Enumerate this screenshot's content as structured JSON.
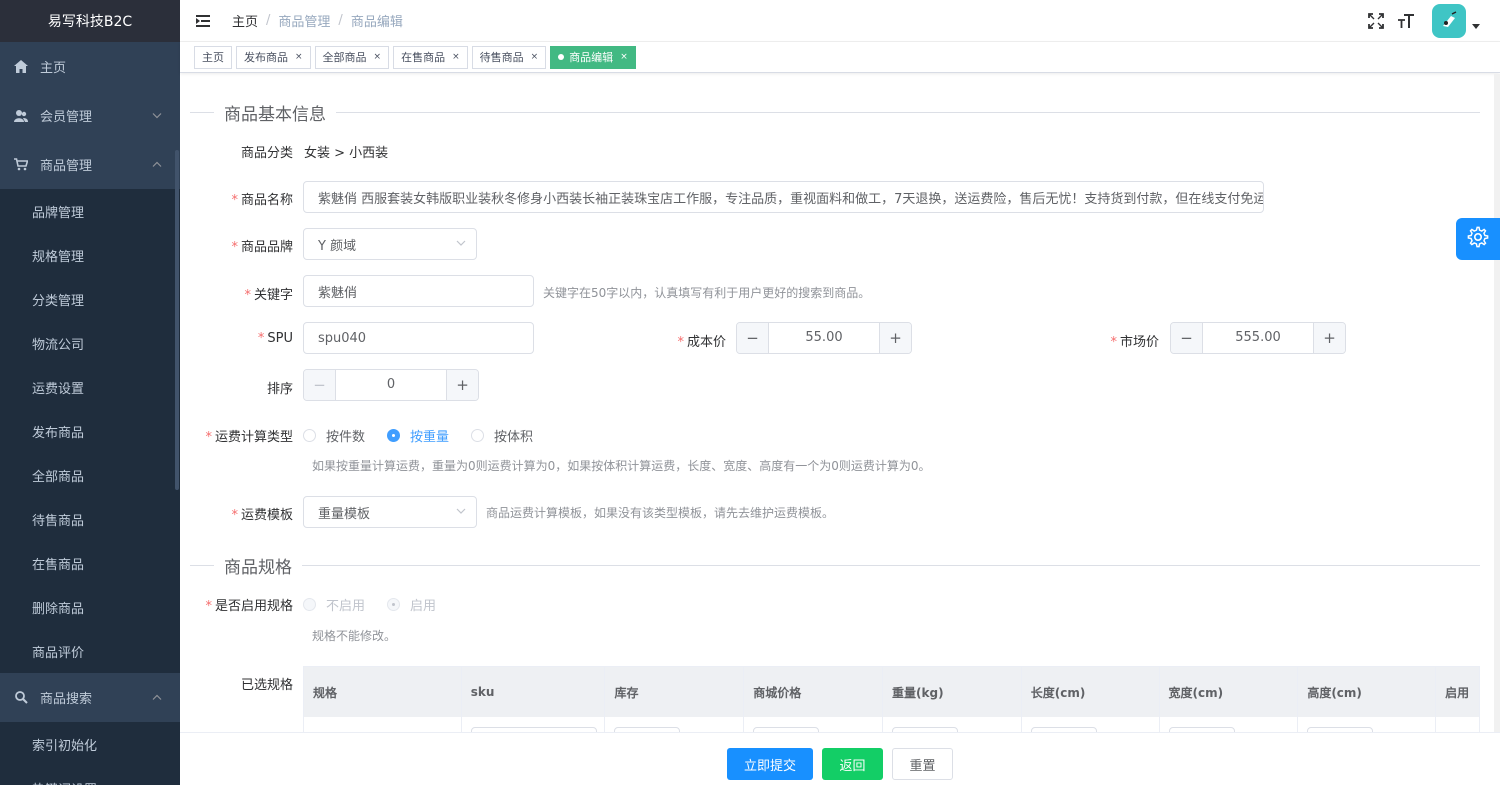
{
  "app": {
    "title": "易写科技B2C"
  },
  "sidebar": {
    "items": [
      {
        "label": "主页",
        "icon": "home-icon"
      },
      {
        "label": "会员管理",
        "icon": "user-icon"
      },
      {
        "label": "商品管理",
        "icon": "cart-icon"
      }
    ],
    "goods_sub": [
      "品牌管理",
      "规格管理",
      "分类管理",
      "物流公司",
      "运费设置",
      "发布商品",
      "全部商品",
      "待售商品",
      "在售商品",
      "删除商品",
      "商品评价"
    ],
    "search": {
      "label": "商品搜索",
      "icon": "search-icon"
    },
    "search_sub": [
      "索引初始化",
      "热键词设置"
    ]
  },
  "breadcrumb": [
    "主页",
    "商品管理",
    "商品编辑"
  ],
  "tabs": [
    {
      "label": "主页",
      "closable": false
    },
    {
      "label": "发布商品",
      "closable": true
    },
    {
      "label": "全部商品",
      "closable": true
    },
    {
      "label": "在售商品",
      "closable": true
    },
    {
      "label": "待售商品",
      "closable": true
    },
    {
      "label": "商品编辑",
      "closable": true,
      "active": true
    }
  ],
  "sections": {
    "basic": "商品基本信息",
    "spec": "商品规格"
  },
  "form": {
    "category": {
      "label": "商品分类",
      "value": "女装 > 小西装"
    },
    "name": {
      "label": "商品名称",
      "value": "紫魅俏 西服套装女韩版职业装秋冬修身小西装长袖正装珠宝店工作服，专注品质，重视面料和做工，7天退换，送运费险，售后无忧！支持货到付款，但在线支付免运费！"
    },
    "brand": {
      "label": "商品品牌",
      "value": "Y 颜域"
    },
    "keyword": {
      "label": "关键字",
      "value": "紫魅俏",
      "hint": "关键字在50字以内，认真填写有利于用户更好的搜索到商品。"
    },
    "spu": {
      "label": "SPU",
      "value": "spu040"
    },
    "cost": {
      "label": "成本价",
      "value": "55.00"
    },
    "market": {
      "label": "市场价",
      "value": "555.00"
    },
    "sort": {
      "label": "排序",
      "value": "0"
    },
    "freight_type": {
      "label": "运费计算类型",
      "options": [
        "按件数",
        "按重量",
        "按体积"
      ],
      "selected": "按重量",
      "hint": "如果按重量计算运费，重量为0则运费计算为0，如果按体积计算运费，长度、宽度、高度有一个为0则运费计算为0。"
    },
    "freight_template": {
      "label": "运费模板",
      "value": "重量模板",
      "hint": "商品运费计算模板，如果没有该类型模板，请先去维护运费模板。"
    },
    "spec_enabled": {
      "label": "是否启用规格",
      "options": [
        "不启用",
        "启用"
      ],
      "selected": "启用",
      "hint": "规格不能修改。"
    },
    "selected_spec_label": "已选规格"
  },
  "table": {
    "columns": [
      "规格",
      "sku",
      "库存",
      "商城价格",
      "重量(kg)",
      "长度(cm)",
      "宽度(cm)",
      "高度(cm)",
      "启用"
    ]
  },
  "footer": {
    "submit": "立即提交",
    "back": "返回",
    "reset": "重置"
  },
  "colors": {
    "sidebar_bg": "#304156",
    "primary": "#1890ff",
    "success": "#13ce66",
    "tag_active": "#42b983",
    "required": "#f56c6c"
  }
}
